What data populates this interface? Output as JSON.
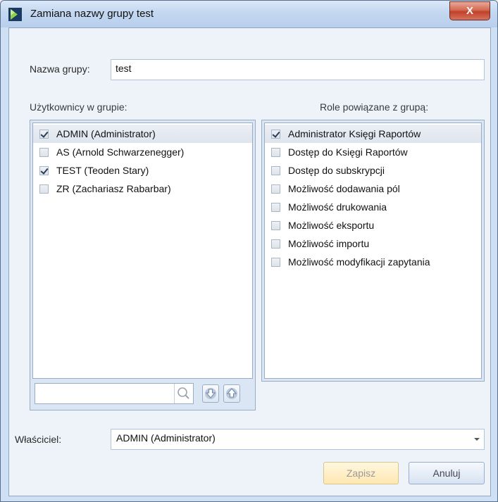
{
  "window": {
    "title": "Zamiana nazwy grupy test",
    "close_label": "X"
  },
  "form": {
    "group_name_label": "Nazwa grupy:",
    "group_name_value": "test",
    "users_label": "Użytkownicy w grupie:",
    "roles_label": "Role powiązane z grupą:",
    "owner_label": "Właściciel:",
    "owner_value": "ADMIN (Administrator)"
  },
  "users": [
    {
      "label": "ADMIN (Administrator)",
      "checked": true,
      "selected": true
    },
    {
      "label": "AS (Arnold Schwarzenegger)",
      "checked": false,
      "selected": false
    },
    {
      "label": "TEST (Teoden Stary)",
      "checked": true,
      "selected": false
    },
    {
      "label": "ZR (Zachariasz Rabarbar)",
      "checked": false,
      "selected": false
    }
  ],
  "roles": [
    {
      "label": "Administrator Księgi Raportów",
      "checked": true,
      "selected": true
    },
    {
      "label": "Dostęp do Księgi Raportów",
      "checked": false,
      "selected": false
    },
    {
      "label": "Dostęp do subskrypcji",
      "checked": false,
      "selected": false
    },
    {
      "label": "Możliwość dodawania pól",
      "checked": false,
      "selected": false
    },
    {
      "label": "Możliwość drukowania",
      "checked": false,
      "selected": false
    },
    {
      "label": "Możliwość eksportu",
      "checked": false,
      "selected": false
    },
    {
      "label": "Możliwość importu",
      "checked": false,
      "selected": false
    },
    {
      "label": "Możliwość modyfikacji zapytania",
      "checked": false,
      "selected": false
    }
  ],
  "search": {
    "value": "",
    "icon": "search-icon"
  },
  "buttons": {
    "save_label": "Zapisz",
    "cancel_label": "Anuluj"
  },
  "colors": {
    "accent": "#1f4e8c",
    "check": "#2a3c57"
  }
}
